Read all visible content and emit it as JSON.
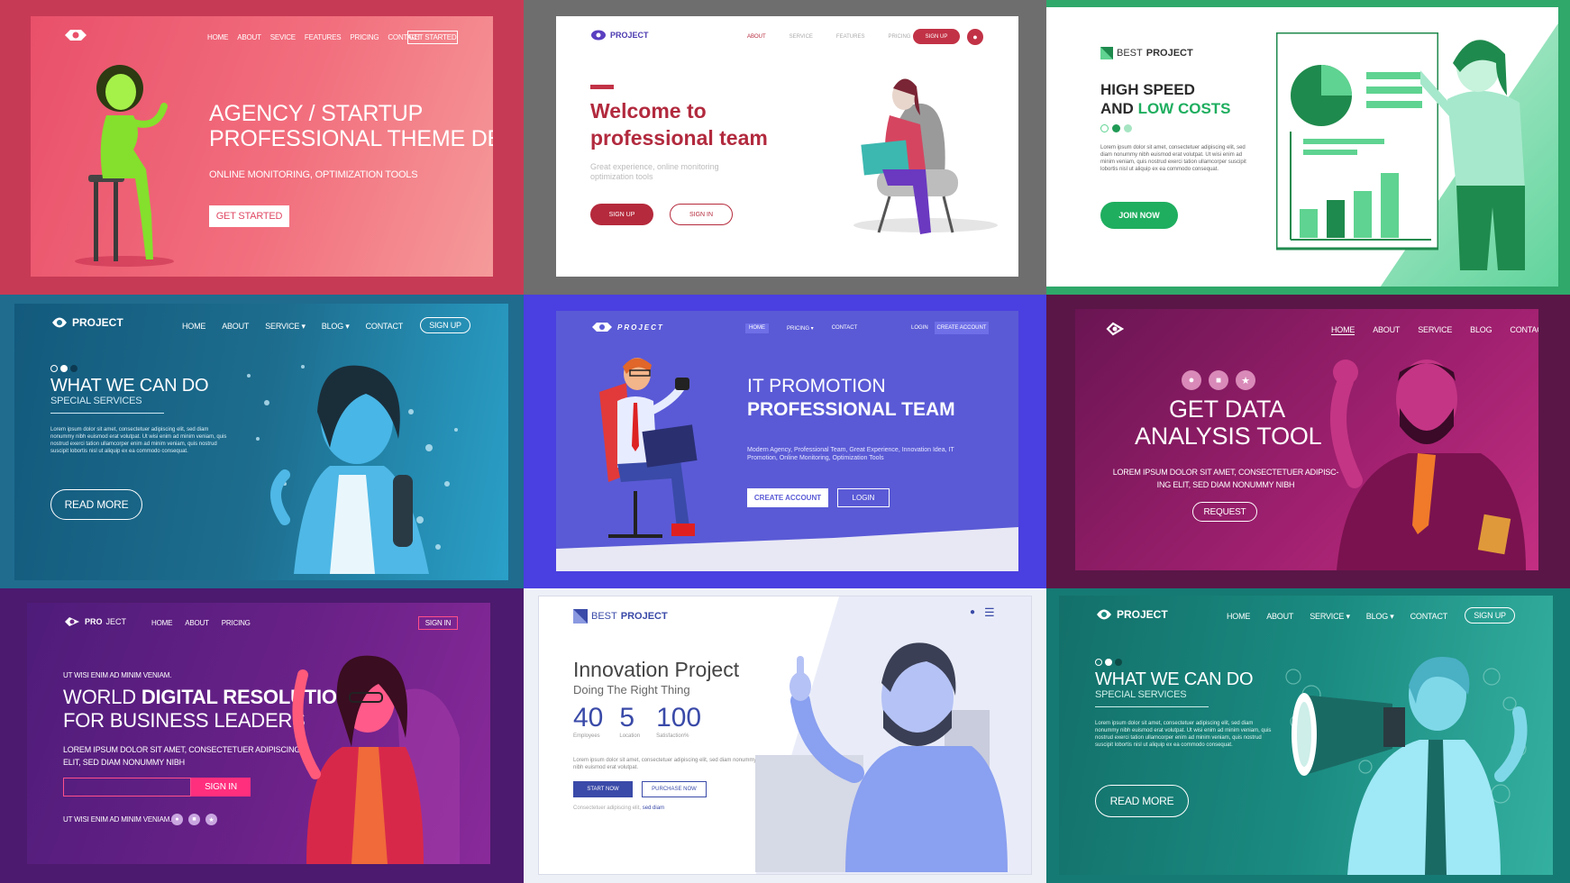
{
  "tiles": {
    "t1": {
      "nav": [
        "HOME",
        "ABOUT",
        "SEVICE",
        "FEATURES",
        "PRICING",
        "CONTACT"
      ],
      "nav_cta": "GET STARTED",
      "headline_1": "AGENCY / STARTUP",
      "headline_2": "PROFESSIONAL THEME DESIGN",
      "subheadline": "ONLINE MONITORING, OPTIMIZATION TOOLS",
      "button": "GET STARTED"
    },
    "t2": {
      "logo": "PROJECT",
      "nav": [
        "ABOUT",
        "SERVICE",
        "FEATURES",
        "PRICING"
      ],
      "nav_cta": "SIGN UP",
      "headline_1": "Welcome to",
      "headline_2": "professional team",
      "body": "Great experience, online monitoring optimization tools",
      "button_primary": "SIGN UP",
      "button_secondary": "SIGN IN"
    },
    "t3": {
      "logo_a": "BEST",
      "logo_b": "PROJECT",
      "headline_1": "HIGH SPEED",
      "headline_2a": "AND ",
      "headline_2b": "LOW COSTS",
      "body": "Lorem ipsum dolor sit amet, consectetuer adipiscing elit, sed diam nonummy nibh euismod erat volutpat. Ut wisi enim ad minim veniam, quis nostrud exerci tation ullamcorper suscipit lobortis nisl ut aliquip ex ea commodo consequat.",
      "button": "JOIN NOW"
    },
    "t4": {
      "logo": "PROJECT",
      "nav": [
        "HOME",
        "ABOUT",
        "SERVICE ▾",
        "BLOG ▾",
        "CONTACT"
      ],
      "nav_cta": "SIGN UP",
      "headline": "WHAT WE CAN DO",
      "subheadline": "SPECIAL SERVICES",
      "body": "Lorem ipsum dolor sit amet, consectetuer adipiscing elit, sed diam nonummy nibh euismod erat volutpat. Ut wisi enim ad minim veniam, quis nostrud exerci tation ullamcorper enim ad minim veniam, quis nostrud suscipit lobortis nisl ut aliquip ex ea commodo consequat.",
      "button": "READ MORE"
    },
    "t5": {
      "logo": "PROJECT",
      "nav": [
        "HOME",
        "PRICING ▾",
        "CONTACT"
      ],
      "nav_login": "LOGIN",
      "nav_cta": "CREATE ACCOUNT",
      "headline_1": "IT PROMOTION",
      "headline_2": "PROFESSIONAL TEAM",
      "body": "Modern Agency, Professional Team, Great Experience, Innovation Idea, IT Promotion, Online Monitoring, Optimization Tools",
      "button_primary": "CREATE ACCOUNT",
      "button_secondary": "LOGIN"
    },
    "t6": {
      "nav": [
        "HOME",
        "ABOUT",
        "SERVICE",
        "BLOG",
        "CONTACT"
      ],
      "headline_1": "GET DATA",
      "headline_2": "ANALYSIS TOOL",
      "body_1": "LOREM IPSUM DOLOR SIT AMET, CONSECTETUER ADIPISC-",
      "body_2": "ING ELIT, SED DIAM NONUMMY NIBH",
      "button": "REQUEST"
    },
    "t7": {
      "logo_a": "PRO",
      "logo_b": "JECT",
      "nav": [
        "HOME",
        "ABOUT",
        "PRICING"
      ],
      "nav_cta": "SIGN IN",
      "eyebrow": "UT WISI ENIM AD MINIM VENIAM.",
      "headline_1a": "WORLD ",
      "headline_1b": "DIGITAL RESOLUTIONS",
      "headline_2": "FOR BUSINESS LEADERS",
      "body_1": "LOREM IPSUM DOLOR SIT AMET, CONSECTETUER ADIPISCING",
      "body_2": "ELIT, SED DIAM NONUMMY NIBH",
      "input_placeholder": "",
      "button": "SIGN IN",
      "footer": "UT WISI ENIM AD MINIM VENIAM."
    },
    "t8": {
      "logo_a": "BEST",
      "logo_b": "PROJECT",
      "headline": "Innovation Project",
      "subheadline": "Doing The Right Thing",
      "stats": [
        {
          "value": "40",
          "label": "Employees"
        },
        {
          "value": "5",
          "label": "Location"
        },
        {
          "value": "100",
          "label": "Satisfaction%"
        }
      ],
      "body": "Lorem ipsum dolor sit amet, consectetuer adipiscing elit, sed diam nonummy nibh euismod erat volutpat.",
      "button_primary": "START NOW",
      "button_secondary": "PURCHASE NOW",
      "footnote_a": "Consectetuer adipiscing elit, ",
      "footnote_b": "sed diam"
    },
    "t9": {
      "logo": "PROJECT",
      "nav": [
        "HOME",
        "ABOUT",
        "SERVICE ▾",
        "BLOG ▾",
        "CONTACT"
      ],
      "nav_cta": "SIGN UP",
      "headline": "WHAT WE CAN DO",
      "subheadline": "SPECIAL SERVICES",
      "body": "Lorem ipsum dolor sit amet, consectetuer adipiscing elit, sed diam nonummy nibh euismod erat volutpat. Ut wisi enim ad minim veniam, quis nostrud exerci tation ullamcorper enim ad minim veniam, quis nostrud suscipit lobortis nisl ut aliquip ex ea commodo consequat.",
      "button": "READ MORE"
    }
  },
  "colors": {
    "pink": "#e8566f",
    "red_accent": "#b52a3c",
    "green": "#1fae5f",
    "blue_teal": "#1d6d8e",
    "indigo": "#5a5ad6",
    "magenta": "#a0206f",
    "purple": "#6a2188",
    "periwinkle": "#3a4aa8",
    "teal": "#1a8a80"
  }
}
